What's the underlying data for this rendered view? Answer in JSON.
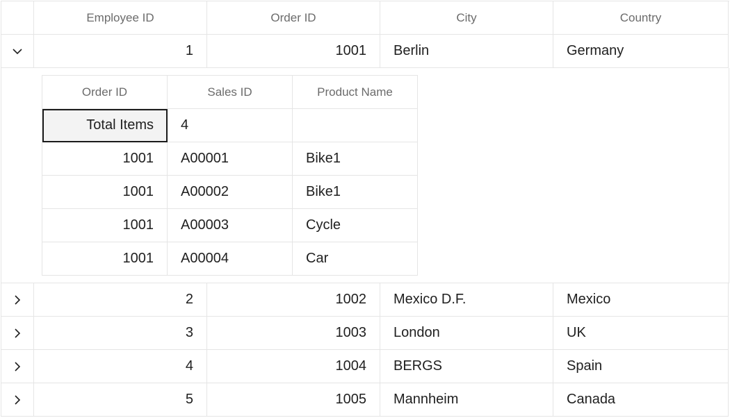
{
  "columns": {
    "employee_id": "Employee ID",
    "order_id": "Order ID",
    "city": "City",
    "country": "Country"
  },
  "rows": [
    {
      "employee_id": "1",
      "order_id": "1001",
      "city": "Berlin",
      "country": "Germany",
      "expanded": true
    },
    {
      "employee_id": "2",
      "order_id": "1002",
      "city": "Mexico D.F.",
      "country": "Mexico",
      "expanded": false
    },
    {
      "employee_id": "3",
      "order_id": "1003",
      "city": "London",
      "country": "UK",
      "expanded": false
    },
    {
      "employee_id": "4",
      "order_id": "1004",
      "city": "BERGS",
      "country": "Spain",
      "expanded": false
    },
    {
      "employee_id": "5",
      "order_id": "1005",
      "city": "Mannheim",
      "country": "Canada",
      "expanded": false
    }
  ],
  "details": {
    "columns": {
      "order_id": "Order ID",
      "sales_id": "Sales ID",
      "product_name": "Product Name"
    },
    "summary": {
      "label": "Total Items",
      "value": "4"
    },
    "rows": [
      {
        "order_id": "1001",
        "sales_id": "A00001",
        "product_name": "Bike1"
      },
      {
        "order_id": "1001",
        "sales_id": "A00002",
        "product_name": "Bike1"
      },
      {
        "order_id": "1001",
        "sales_id": "A00003",
        "product_name": "Cycle"
      },
      {
        "order_id": "1001",
        "sales_id": "A00004",
        "product_name": "Car"
      }
    ]
  },
  "icons": {
    "expanded": "chevron-down-icon",
    "collapsed": "chevron-right-icon"
  },
  "colors": {
    "border": "#e5e5e5",
    "header_text": "#6b6b6b",
    "cell_text": "#1f1f1f",
    "summary_background": "#f3f3f3",
    "focus_border": "#1a1a1a"
  }
}
